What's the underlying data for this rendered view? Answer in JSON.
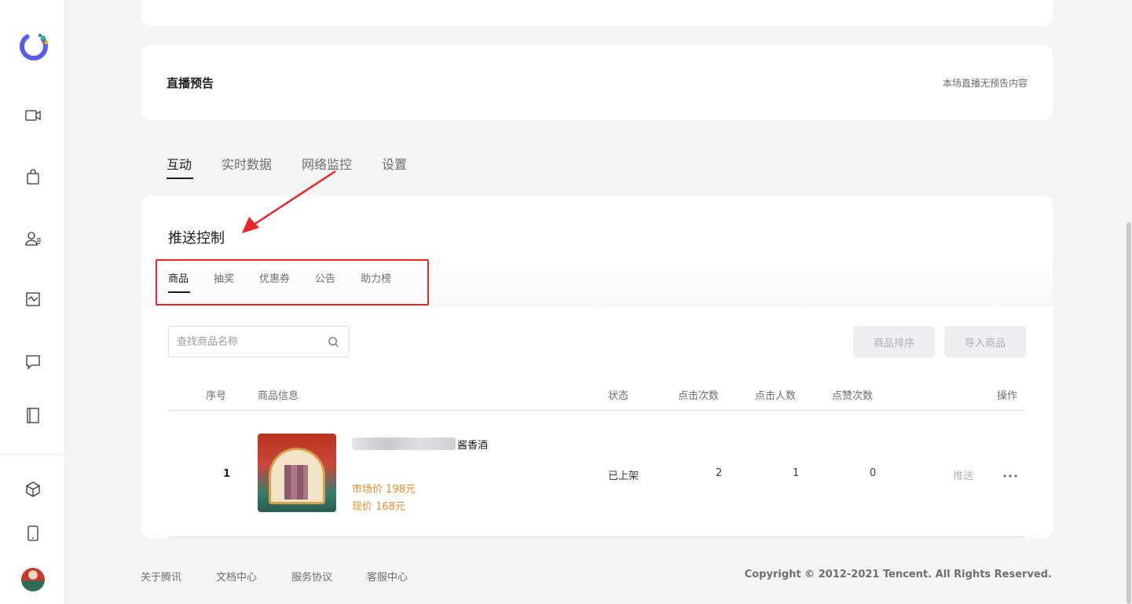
{
  "preview": {
    "title": "直播预告",
    "note": "本场直播无预告内容"
  },
  "main_tabs": [
    {
      "label": "互动",
      "active": true
    },
    {
      "label": "实时数据",
      "active": false
    },
    {
      "label": "网络监控",
      "active": false
    },
    {
      "label": "设置",
      "active": false
    }
  ],
  "push": {
    "title": "推送控制",
    "sub_tabs": [
      {
        "label": "商品",
        "active": true
      },
      {
        "label": "抽奖",
        "active": false
      },
      {
        "label": "优惠券",
        "active": false
      },
      {
        "label": "公告",
        "active": false
      },
      {
        "label": "助力榜",
        "active": false
      }
    ],
    "search_placeholder": "查找商品名称",
    "sort_button": "商品排序",
    "import_button": "导入商品"
  },
  "table": {
    "headers": {
      "index": "序号",
      "info": "商品信息",
      "status": "状态",
      "clicks": "点击次数",
      "click_users": "点击人数",
      "likes": "点赞次数",
      "actions": "操作"
    },
    "rows": [
      {
        "index": "1",
        "name": "酱香酒",
        "market_price": "市场价 198元",
        "current_price": "现价 168元",
        "status": "已上架",
        "clicks": "2",
        "click_users": "1",
        "likes": "0",
        "action": "推送"
      }
    ]
  },
  "footer": {
    "links": [
      "关于腾讯",
      "文档中心",
      "服务协议",
      "客服中心"
    ],
    "copyright": "Copyright © 2012-2021 Tencent. All Rights Reserved."
  },
  "icons": {
    "logo": "live-logo-icon",
    "sidebar": [
      "video-camera-icon",
      "shopping-bag-icon",
      "user-list-icon",
      "chart-icon",
      "chat-icon",
      "book-icon",
      "cube-icon",
      "mobile-phone-icon"
    ]
  },
  "colors": {
    "accent_purple": "#5b5ce6",
    "price_orange": "#e8882a",
    "annotation_red": "#e8262a"
  }
}
